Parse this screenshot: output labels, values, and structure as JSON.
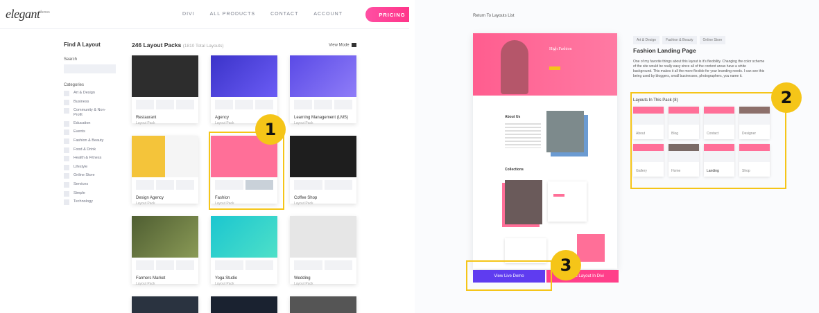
{
  "left": {
    "logo": "elegant",
    "logo_sub": "themes",
    "nav": [
      "DIVI",
      "ALL PRODUCTS",
      "CONTACT",
      "ACCOUNT"
    ],
    "pricing": "PRICING",
    "sidebar": {
      "title": "Find A Layout",
      "search_label": "Search",
      "categories_label": "Categories",
      "categories": [
        "Art & Design",
        "Business",
        "Community & Non-Profit",
        "Education",
        "Events",
        "Fashion & Beauty",
        "Food & Drink",
        "Health & Fitness",
        "Lifestyle",
        "Online Store",
        "Services",
        "Simple",
        "Technology"
      ]
    },
    "count": "246 Layout Packs",
    "count_sub": "(1810 Total Layouts)",
    "view_mode": "View Mode",
    "pack_label": "Layout Pack",
    "cards": [
      {
        "title": "Restaurant",
        "color": "#2d2d2d"
      },
      {
        "title": "Agency",
        "color": "#4b3fd8"
      },
      {
        "title": "Learning Management (LMS)",
        "color": "#6a5cf0"
      },
      {
        "title": "Design Agency",
        "color": "#f4c43a"
      },
      {
        "title": "Fashion",
        "color": "#ff6f98"
      },
      {
        "title": "Coffee Shop",
        "color": "#1e1e1e"
      },
      {
        "title": "Farmers Market",
        "color": "#5b6a3a"
      },
      {
        "title": "Yoga Studio",
        "color": "#2ad1d6"
      },
      {
        "title": "Wedding",
        "color": "#d9d9d9"
      }
    ],
    "callout": "1"
  },
  "right": {
    "return": "Return To Layouts List",
    "hero_text": "High Fashion",
    "about": "About Us",
    "collections": "Collections",
    "tags": [
      "Art & Design",
      "Fashion & Beauty",
      "Online Store"
    ],
    "title": "Fashion Landing Page",
    "description": "One of my favorite things about this layout is it's flexibility. Changing the color scheme of the site would be really easy since all of the content areas have a white background. This makes it all the more flexible for your branding needs. I can see this being used by bloggers, small businesses, photographers, you name it.",
    "layouts_title": "Layouts In This Pack (8)",
    "layouts": [
      "About",
      "Blog",
      "Contact",
      "Designer",
      "Gallery",
      "Home",
      "Landing",
      "Shop"
    ],
    "demo_button": "View Live Demo",
    "divi_button": "Use This Layout In Divi",
    "callout2": "2",
    "callout3": "3"
  }
}
